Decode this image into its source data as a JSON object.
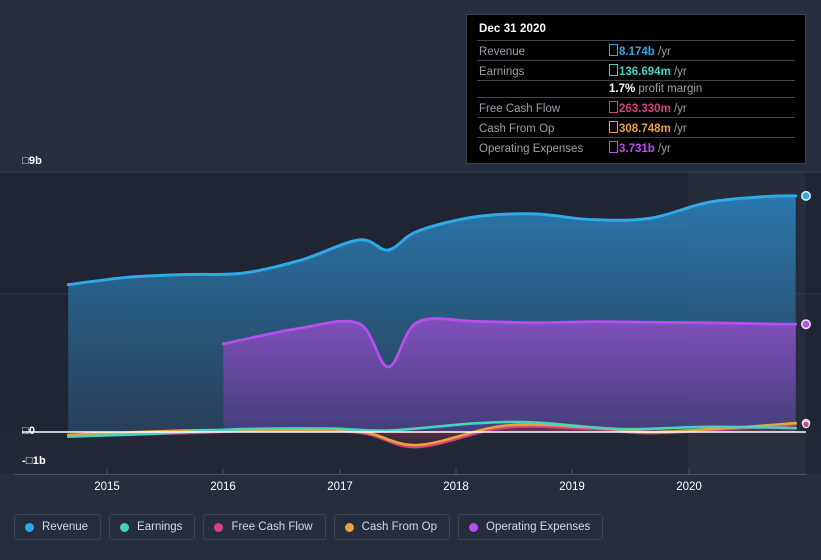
{
  "chart_data": {
    "type": "area",
    "title": "",
    "xlabel": "",
    "ylabel": "",
    "currency_symbol": "□",
    "x_tick_labels": [
      "2015",
      "2016",
      "2017",
      "2018",
      "2019",
      "2020"
    ],
    "y_tick_labels": [
      "□9b",
      "□0",
      "-□1b"
    ],
    "ylim": [
      -1,
      9
    ],
    "y_unit": "b",
    "grid": true,
    "legend_position": "bottom",
    "highlight_band": {
      "from": "2020-04",
      "to": "2020-12"
    },
    "series": [
      {
        "name": "Revenue",
        "color": "#2eaae8",
        "fill": true,
        "x": [
          "2014-09",
          "2015-03",
          "2015-09",
          "2016-03",
          "2016-09",
          "2017-03",
          "2017-06",
          "2017-09",
          "2018-03",
          "2018-09",
          "2019-03",
          "2019-09",
          "2020-03",
          "2020-09",
          "2020-12"
        ],
        "values": [
          5.1,
          5.35,
          5.45,
          5.5,
          5.95,
          6.65,
          6.3,
          6.95,
          7.45,
          7.55,
          7.35,
          7.4,
          7.95,
          8.15,
          8.174
        ]
      },
      {
        "name": "Operating Expenses",
        "color": "#b84ef0",
        "fill": true,
        "x": [
          "2016-01",
          "2016-09",
          "2017-03",
          "2017-06",
          "2017-09",
          "2018-03",
          "2018-09",
          "2019-03",
          "2019-09",
          "2020-03",
          "2020-09",
          "2020-12"
        ],
        "values": [
          3.05,
          3.6,
          3.75,
          2.25,
          3.8,
          3.83,
          3.78,
          3.82,
          3.8,
          3.78,
          3.74,
          3.731
        ]
      },
      {
        "name": "Earnings",
        "color": "#4ad2c0",
        "fill": false,
        "x": [
          "2014-09",
          "2015-06",
          "2016-03",
          "2016-12",
          "2017-06",
          "2018-03",
          "2018-09",
          "2019-06",
          "2020-03",
          "2020-12"
        ],
        "values": [
          -0.16,
          -0.06,
          0.1,
          0.12,
          0.05,
          0.3,
          0.33,
          0.1,
          0.18,
          0.136694
        ]
      },
      {
        "name": "Free Cash Flow",
        "color": "#d4447e",
        "fill": false,
        "x": [
          "2014-09",
          "2015-09",
          "2016-06",
          "2017-03",
          "2017-09",
          "2018-06",
          "2019-03",
          "2019-09",
          "2020-06",
          "2020-12"
        ],
        "values": [
          -0.12,
          -0.04,
          0.06,
          -0.02,
          -0.52,
          0.15,
          0.1,
          -0.04,
          0.12,
          0.26333
        ]
      },
      {
        "name": "Cash From Op",
        "color": "#e8a33c",
        "fill": false,
        "x": [
          "2014-09",
          "2015-09",
          "2016-06",
          "2017-03",
          "2017-09",
          "2018-06",
          "2019-03",
          "2019-09",
          "2020-06",
          "2020-12"
        ],
        "values": [
          -0.1,
          0.05,
          0.07,
          0.02,
          -0.45,
          0.22,
          0.16,
          0.0,
          0.16,
          0.308748
        ]
      }
    ]
  },
  "tooltip": {
    "title": "Dec 31 2020",
    "rows": [
      {
        "label": "Revenue",
        "symbol": "□",
        "amount": "8.174b",
        "unit": "/yr",
        "color": "#2eaae8"
      },
      {
        "label": "Earnings",
        "symbol": "□",
        "amount": "136.694m",
        "unit": "/yr",
        "color": "#4ad2c0"
      },
      {
        "label": "Free Cash Flow",
        "symbol": "□",
        "amount": "263.330m",
        "unit": "/yr",
        "color": "#d4447e"
      },
      {
        "label": "Cash From Op",
        "symbol": "□",
        "amount": "308.748m",
        "unit": "/yr",
        "color": "#e8a33c"
      },
      {
        "label": "Operating Expenses",
        "symbol": "□",
        "amount": "3.731b",
        "unit": "/yr",
        "color": "#b84ef0"
      }
    ],
    "profit_margin_value": "1.7%",
    "profit_margin_label": "profit margin"
  },
  "legend": {
    "items": [
      {
        "label": "Revenue",
        "color": "#2eaae8"
      },
      {
        "label": "Earnings",
        "color": "#4ad2c0"
      },
      {
        "label": "Free Cash Flow",
        "color": "#d4447e"
      },
      {
        "label": "Cash From Op",
        "color": "#e8a33c"
      },
      {
        "label": "Operating Expenses",
        "color": "#b84ef0"
      }
    ]
  },
  "axis": {
    "y_top": "□9b",
    "y_zero": "□0",
    "y_neg": "-□1b",
    "x_ticks": [
      "2015",
      "2016",
      "2017",
      "2018",
      "2019",
      "2020"
    ]
  },
  "colors": {
    "background": "#262d3d",
    "plot_background": "#1f2532",
    "gridline": "#3d4455",
    "zero_line": "#ffffff",
    "tooltip_background": "#000000"
  }
}
